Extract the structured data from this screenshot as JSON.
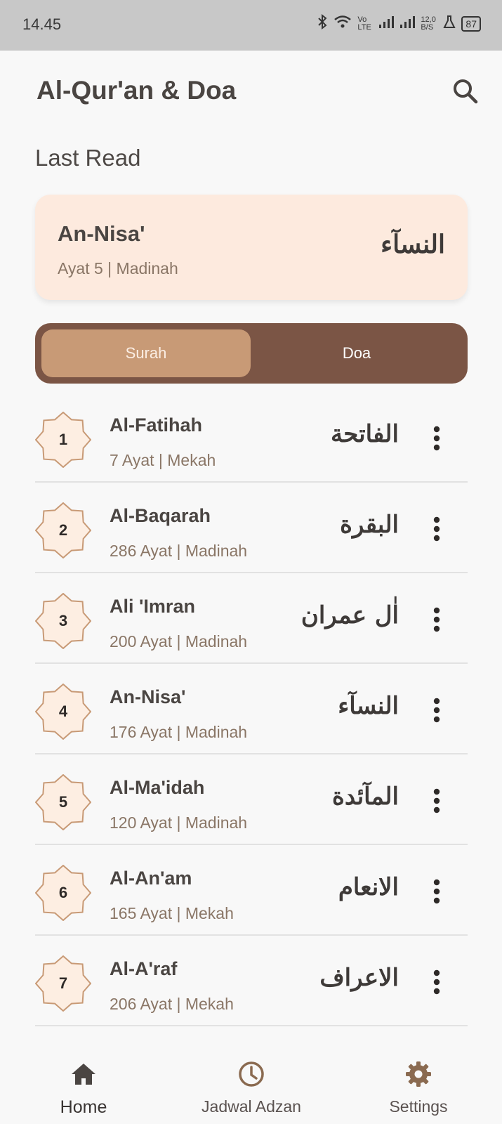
{
  "status_bar": {
    "time": "14.45",
    "network": "Vo LTE",
    "speed": "12,0 B/S",
    "battery": "87"
  },
  "app": {
    "title": "Al-Qur'an & Doa"
  },
  "last_read": {
    "label": "Last Read",
    "surah": "An-Nisa'",
    "meta": "Ayat 5 | Madinah",
    "arabic": "النسآء"
  },
  "tabs": [
    {
      "label": "Surah",
      "active": true
    },
    {
      "label": "Doa",
      "active": false
    }
  ],
  "surahs": [
    {
      "number": "1",
      "name": "Al-Fatihah",
      "meta": "7 Ayat | Mekah",
      "arabic": "الفاتحة"
    },
    {
      "number": "2",
      "name": "Al-Baqarah",
      "meta": "286 Ayat | Madinah",
      "arabic": "البقرة"
    },
    {
      "number": "3",
      "name": "Ali 'Imran",
      "meta": "200 Ayat | Madinah",
      "arabic": "اٰل عمران"
    },
    {
      "number": "4",
      "name": "An-Nisa'",
      "meta": "176 Ayat | Madinah",
      "arabic": "النسآء"
    },
    {
      "number": "5",
      "name": "Al-Ma'idah",
      "meta": "120 Ayat | Madinah",
      "arabic": "المآئدة"
    },
    {
      "number": "6",
      "name": "Al-An'am",
      "meta": "165 Ayat | Mekah",
      "arabic": "الانعام"
    },
    {
      "number": "7",
      "name": "Al-A'raf",
      "meta": "206 Ayat | Mekah",
      "arabic": "الاعراف"
    }
  ],
  "bottom_nav": [
    {
      "label": "Home",
      "icon": "home-icon",
      "active": true
    },
    {
      "label": "Jadwal Adzan",
      "icon": "clock-icon",
      "active": false
    },
    {
      "label": "Settings",
      "icon": "gear-icon",
      "active": false
    }
  ],
  "colors": {
    "accent_dark": "#7b5545",
    "accent_light": "#c89a76",
    "card_bg": "#fdeade",
    "star_fill": "#fdeee2",
    "star_stroke": "#c89a76"
  }
}
